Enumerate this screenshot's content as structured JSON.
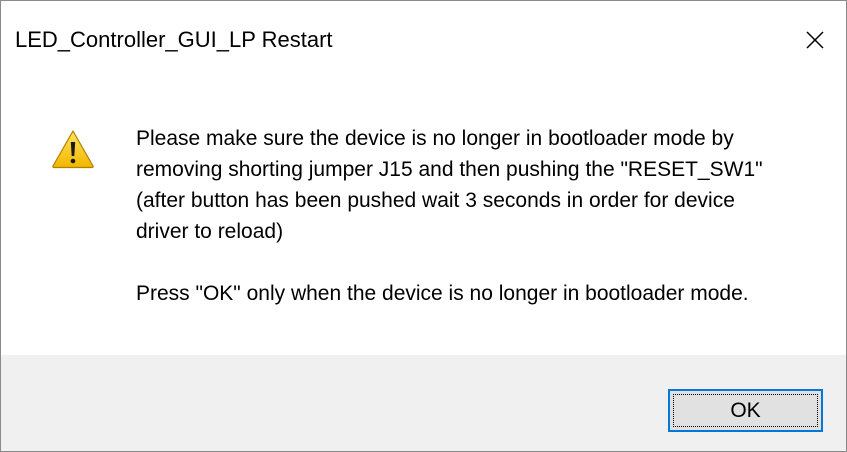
{
  "window": {
    "title": "LED_Controller_GUI_LP Restart",
    "close_icon": "close-icon"
  },
  "message": {
    "icon": "warning-icon",
    "paragraph1_lines": [
      "Please make sure the device is no longer in bootloader mode by",
      "removing shorting jumper J15 and then pushing the \"RESET_SW1\"",
      "(after button has been pushed wait 3 seconds in order for device",
      "driver to reload)"
    ],
    "paragraph2": "Press \"OK\" only when the device is no longer in bootloader mode."
  },
  "buttons": {
    "ok_label": "OK"
  },
  "colors": {
    "footer_background": "#f0f0f0",
    "button_face": "#e1e1e1",
    "button_focus_border": "#0078d7",
    "warning_yellow": "#f4c20d"
  }
}
